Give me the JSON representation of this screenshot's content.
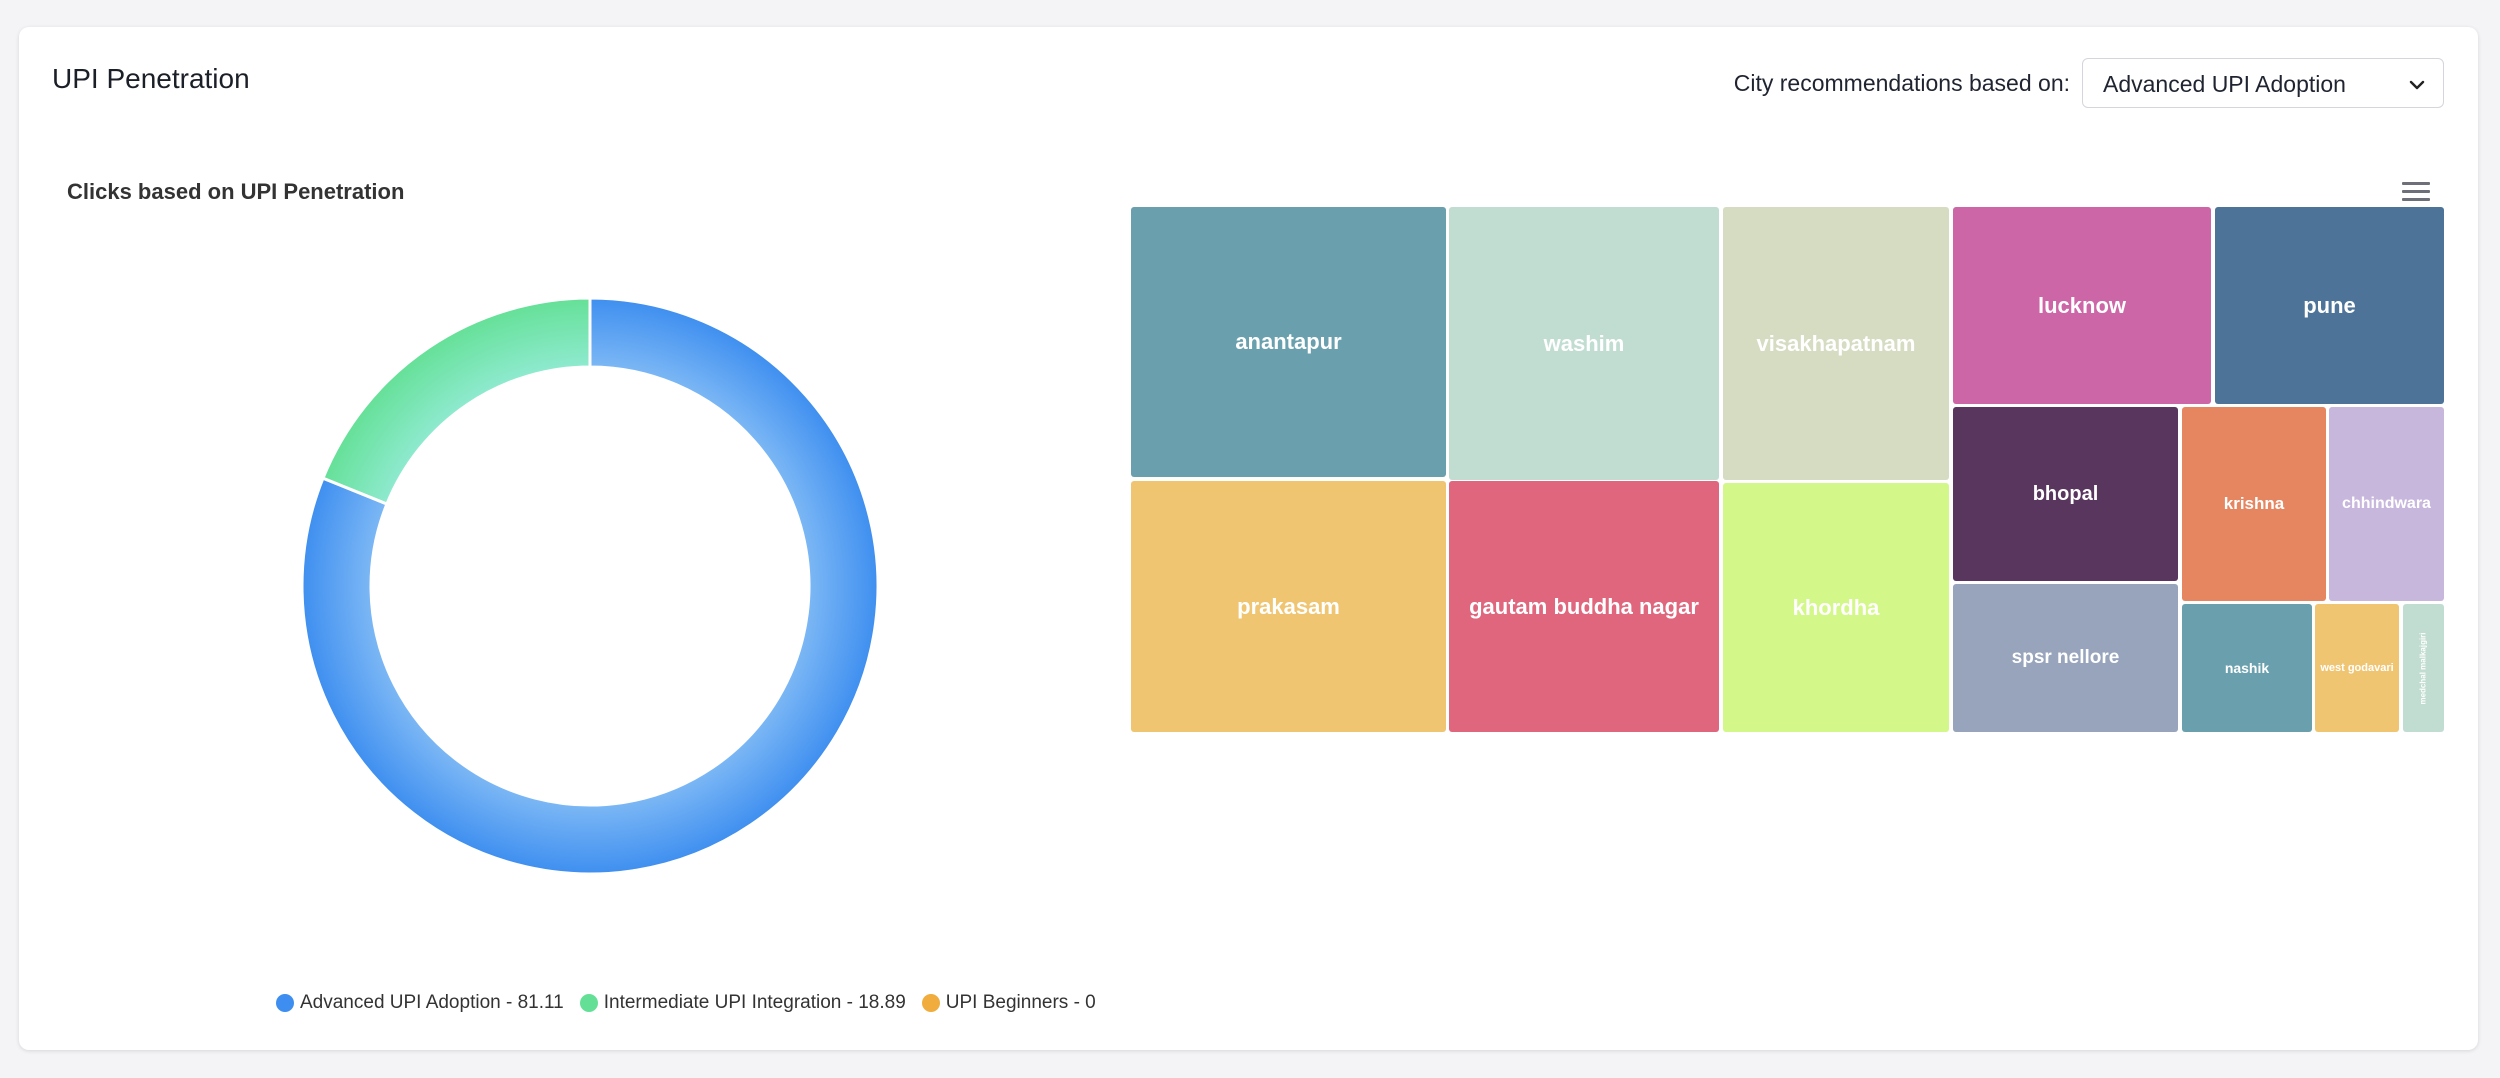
{
  "page": {
    "title": "UPI Penetration"
  },
  "recommendation": {
    "label": "City recommendations based on:",
    "selected": "Advanced UPI Adoption"
  },
  "donut_chart": {
    "title": "Clicks based on UPI Penetration",
    "legend": [
      {
        "label": "Advanced UPI Adoption - 81.11",
        "color": "#3d8ef0"
      },
      {
        "label": "Intermediate UPI Integration - 18.89",
        "color": "#64e096"
      },
      {
        "label": "UPI Beginners - 0",
        "color": "#f0ac3c"
      }
    ]
  },
  "treemap": {
    "tiles": [
      {
        "name": "anantapur",
        "color": "#6aa0ae"
      },
      {
        "name": "washim",
        "color": "#c1ddd1"
      },
      {
        "name": "visakhapatnam",
        "color": "#d5dcc2"
      },
      {
        "name": "lucknow",
        "color": "#cc66a6"
      },
      {
        "name": "pune",
        "color": "#4d7399"
      },
      {
        "name": "prakasam",
        "color": "#f0c572"
      },
      {
        "name": "gautam buddha nagar",
        "color": "#e0667e"
      },
      {
        "name": "khordha",
        "color": "#d4f78a"
      },
      {
        "name": "bhopal",
        "color": "#59365e"
      },
      {
        "name": "krishna",
        "color": "#e58661"
      },
      {
        "name": "chhindwara",
        "color": "#c8b7dd"
      },
      {
        "name": "spsr nellore",
        "color": "#97a4bc"
      },
      {
        "name": "nashik",
        "color": "#6aa0ae"
      },
      {
        "name": "west godavari",
        "color": "#f0c572"
      },
      {
        "name": "medchal malkajgiri",
        "color": "#c1ddd1"
      }
    ]
  },
  "chart_data": {
    "type": "pie",
    "title": "Clicks based on UPI Penetration",
    "categories": [
      "Advanced UPI Adoption",
      "Intermediate UPI Integration",
      "UPI Beginners"
    ],
    "values": [
      81.11,
      18.89,
      0
    ],
    "colors": [
      "#3d8ef0",
      "#64e096",
      "#f0ac3c"
    ]
  }
}
